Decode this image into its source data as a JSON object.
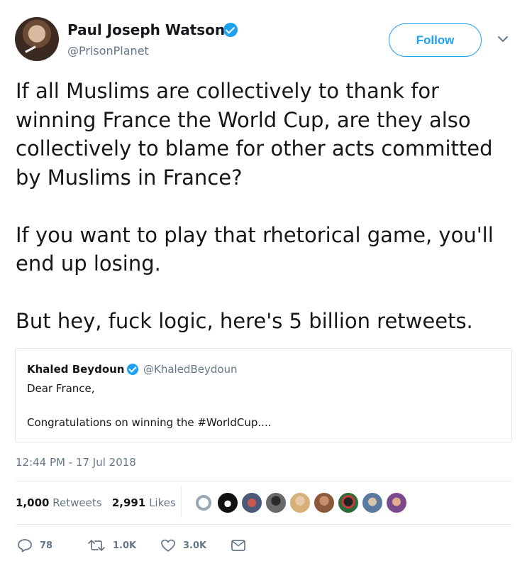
{
  "author": {
    "name": "Paul Joseph Watson",
    "handle": "@PrisonPlanet",
    "follow_label": "Follow"
  },
  "tweet": {
    "text": "If all Muslims are collectively to thank for\nwinning France the World Cup, are they also\ncollectively to blame for other acts committed\nby Muslims in France?\n\nIf you want to play that rhetorical game, you'll\nend up losing.\n\nBut hey, fuck logic, here's 5 billion retweets."
  },
  "quoted": {
    "name": "Khaled Beydoun",
    "handle": "@KhaledBeydoun",
    "line1": "Dear France,",
    "line2": "Congratulations on winning the #WorldCup...."
  },
  "timestamp": "12:44 PM - 17 Jul 2018",
  "stats": {
    "retweets_count": "1,000",
    "retweets_label": "Retweets",
    "likes_count": "2,991",
    "likes_label": "Likes"
  },
  "actions": {
    "replies": "78",
    "retweets": "1.0K",
    "likes": "3.0K"
  },
  "colors": {
    "accent": "#1da1f2",
    "muted": "#657786",
    "text": "#14171a",
    "border": "#e6ecf0"
  },
  "icons": [
    "verified-badge-icon",
    "chevron-down-icon",
    "reply-icon",
    "retweet-icon",
    "heart-icon",
    "direct-message-icon"
  ]
}
